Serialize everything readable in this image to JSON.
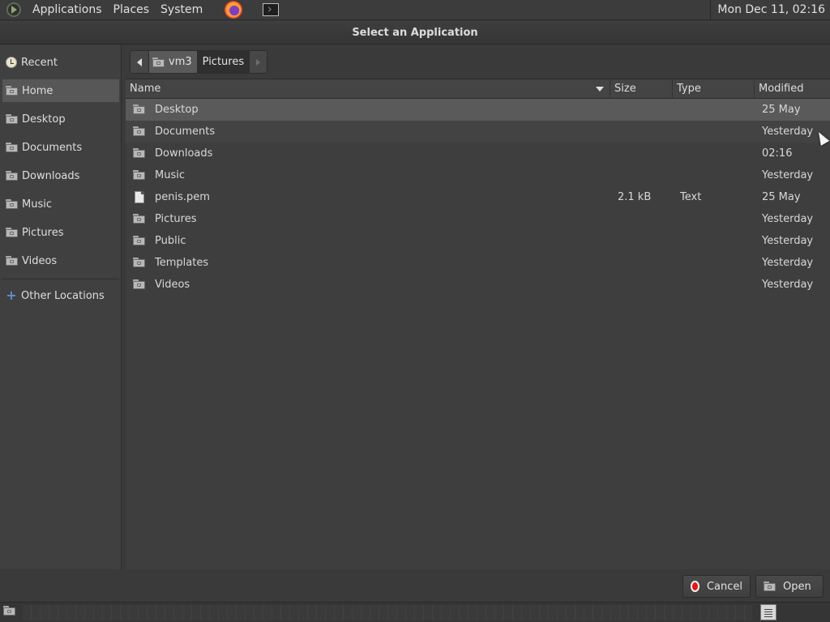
{
  "top_panel": {
    "menus": [
      "Applications",
      "Places",
      "System"
    ],
    "clock": "Mon Dec 11, 02:16"
  },
  "dialog": {
    "title": "Select an Application"
  },
  "sidebar": {
    "items": [
      {
        "label": "Recent",
        "icon": "recent-icon"
      },
      {
        "label": "Home",
        "icon": "home-folder-icon",
        "active": true
      },
      {
        "label": "Desktop",
        "icon": "folder-icon"
      },
      {
        "label": "Documents",
        "icon": "folder-icon"
      },
      {
        "label": "Downloads",
        "icon": "folder-icon"
      },
      {
        "label": "Music",
        "icon": "folder-icon"
      },
      {
        "label": "Pictures",
        "icon": "folder-icon"
      },
      {
        "label": "Videos",
        "icon": "folder-icon"
      }
    ],
    "other": {
      "label": "Other Locations",
      "icon": "plus-icon"
    }
  },
  "pathbar": {
    "home": "vm3",
    "current": "Pictures"
  },
  "columns": {
    "name": "Name",
    "size": "Size",
    "type": "Type",
    "modified": "Modified"
  },
  "files": [
    {
      "name": "Desktop",
      "size": "",
      "type": "",
      "modified": "25 May",
      "kind": "folder"
    },
    {
      "name": "Documents",
      "size": "",
      "type": "",
      "modified": "Yesterday",
      "kind": "folder"
    },
    {
      "name": "Downloads",
      "size": "",
      "type": "",
      "modified": "02:16",
      "kind": "folder"
    },
    {
      "name": "Music",
      "size": "",
      "type": "",
      "modified": "Yesterday",
      "kind": "folder"
    },
    {
      "name": "penis.pem",
      "size": "2.1 kB",
      "type": "Text",
      "modified": "25 May",
      "kind": "file"
    },
    {
      "name": "Pictures",
      "size": "",
      "type": "",
      "modified": "Yesterday",
      "kind": "folder"
    },
    {
      "name": "Public",
      "size": "",
      "type": "",
      "modified": "Yesterday",
      "kind": "folder"
    },
    {
      "name": "Templates",
      "size": "",
      "type": "",
      "modified": "Yesterday",
      "kind": "folder"
    },
    {
      "name": "Videos",
      "size": "",
      "type": "",
      "modified": "Yesterday",
      "kind": "folder"
    }
  ],
  "buttons": {
    "cancel": "Cancel",
    "open": "Open"
  }
}
